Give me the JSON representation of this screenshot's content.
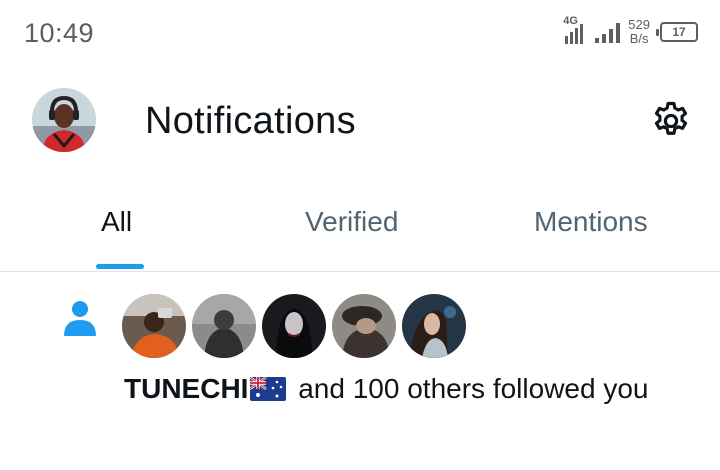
{
  "status_bar": {
    "time": "10:49",
    "network_type": "4G",
    "speed_value": "529",
    "speed_unit": "B/s",
    "battery": "17"
  },
  "header": {
    "title": "Notifications",
    "avatar_icon": "profile-avatar",
    "settings_icon": "gear-icon"
  },
  "tabs": [
    {
      "label": "All",
      "active": true
    },
    {
      "label": "Verified",
      "active": false
    },
    {
      "label": "Mentions",
      "active": false
    }
  ],
  "notification": {
    "icon": "person-icon",
    "user": "TUNECHI",
    "flag": "australia-flag",
    "text_rest": " and 100 others followed you",
    "avatar_count": 5
  },
  "colors": {
    "accent": "#1d9bf0",
    "primary_text": "#0f1419",
    "secondary_text": "#536471",
    "divider": "#e1e4e6"
  }
}
